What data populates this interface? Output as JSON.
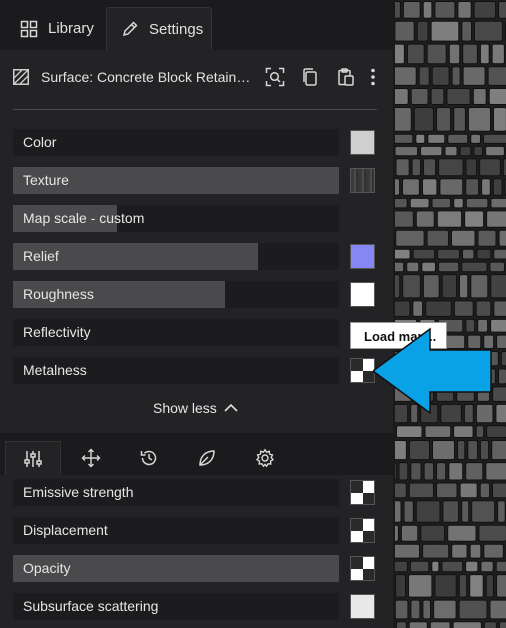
{
  "tabs": [
    {
      "label": "Library",
      "icon": "grid-icon",
      "active": false
    },
    {
      "label": "Settings",
      "icon": "pencil-icon",
      "active": true
    }
  ],
  "surface": {
    "title": "Surface: Concrete Block Retaining Wall",
    "icon": "hatch-icon",
    "actions": [
      "scan-search-icon",
      "copy-icon",
      "paste-icon",
      "more-icon"
    ]
  },
  "properties": [
    {
      "label": "Color",
      "fill": 0,
      "swatch": "#cfcfcf"
    },
    {
      "label": "Texture",
      "fill": 1.0,
      "swatch": "texture"
    },
    {
      "label": "Map scale - custom",
      "fill": 0.32,
      "swatch": null
    },
    {
      "label": "Relief",
      "fill": 0.75,
      "swatch": "#8686f5"
    },
    {
      "label": "Roughness",
      "fill": 0.65,
      "swatch": "#ffffff"
    },
    {
      "label": "Reflectivity",
      "fill": 0,
      "swatch": null
    },
    {
      "label": "Metalness",
      "fill": 0,
      "swatch": "checker"
    }
  ],
  "tooltip": "Load map...",
  "show_less": "Show less",
  "toolbar": [
    "sliders-icon",
    "move-icon",
    "history-icon",
    "leaf-icon",
    "gear-icon"
  ],
  "bottom_properties": [
    {
      "label": "Emissive strength",
      "fill": 0,
      "swatch": "checker"
    },
    {
      "label": "Displacement",
      "fill": 0,
      "swatch": "checker"
    },
    {
      "label": "Opacity",
      "fill": 1.0,
      "swatch": "checker"
    },
    {
      "label": "Subsurface scattering",
      "fill": 0,
      "swatch": "#e8e8e8"
    }
  ],
  "colors": {
    "panel_bg": "#232325",
    "row_bg": "#1c1c1e",
    "row_fill": "#4a4a4c",
    "arrow": "#0aa2e6",
    "relief_swatch": "#8686f5"
  }
}
